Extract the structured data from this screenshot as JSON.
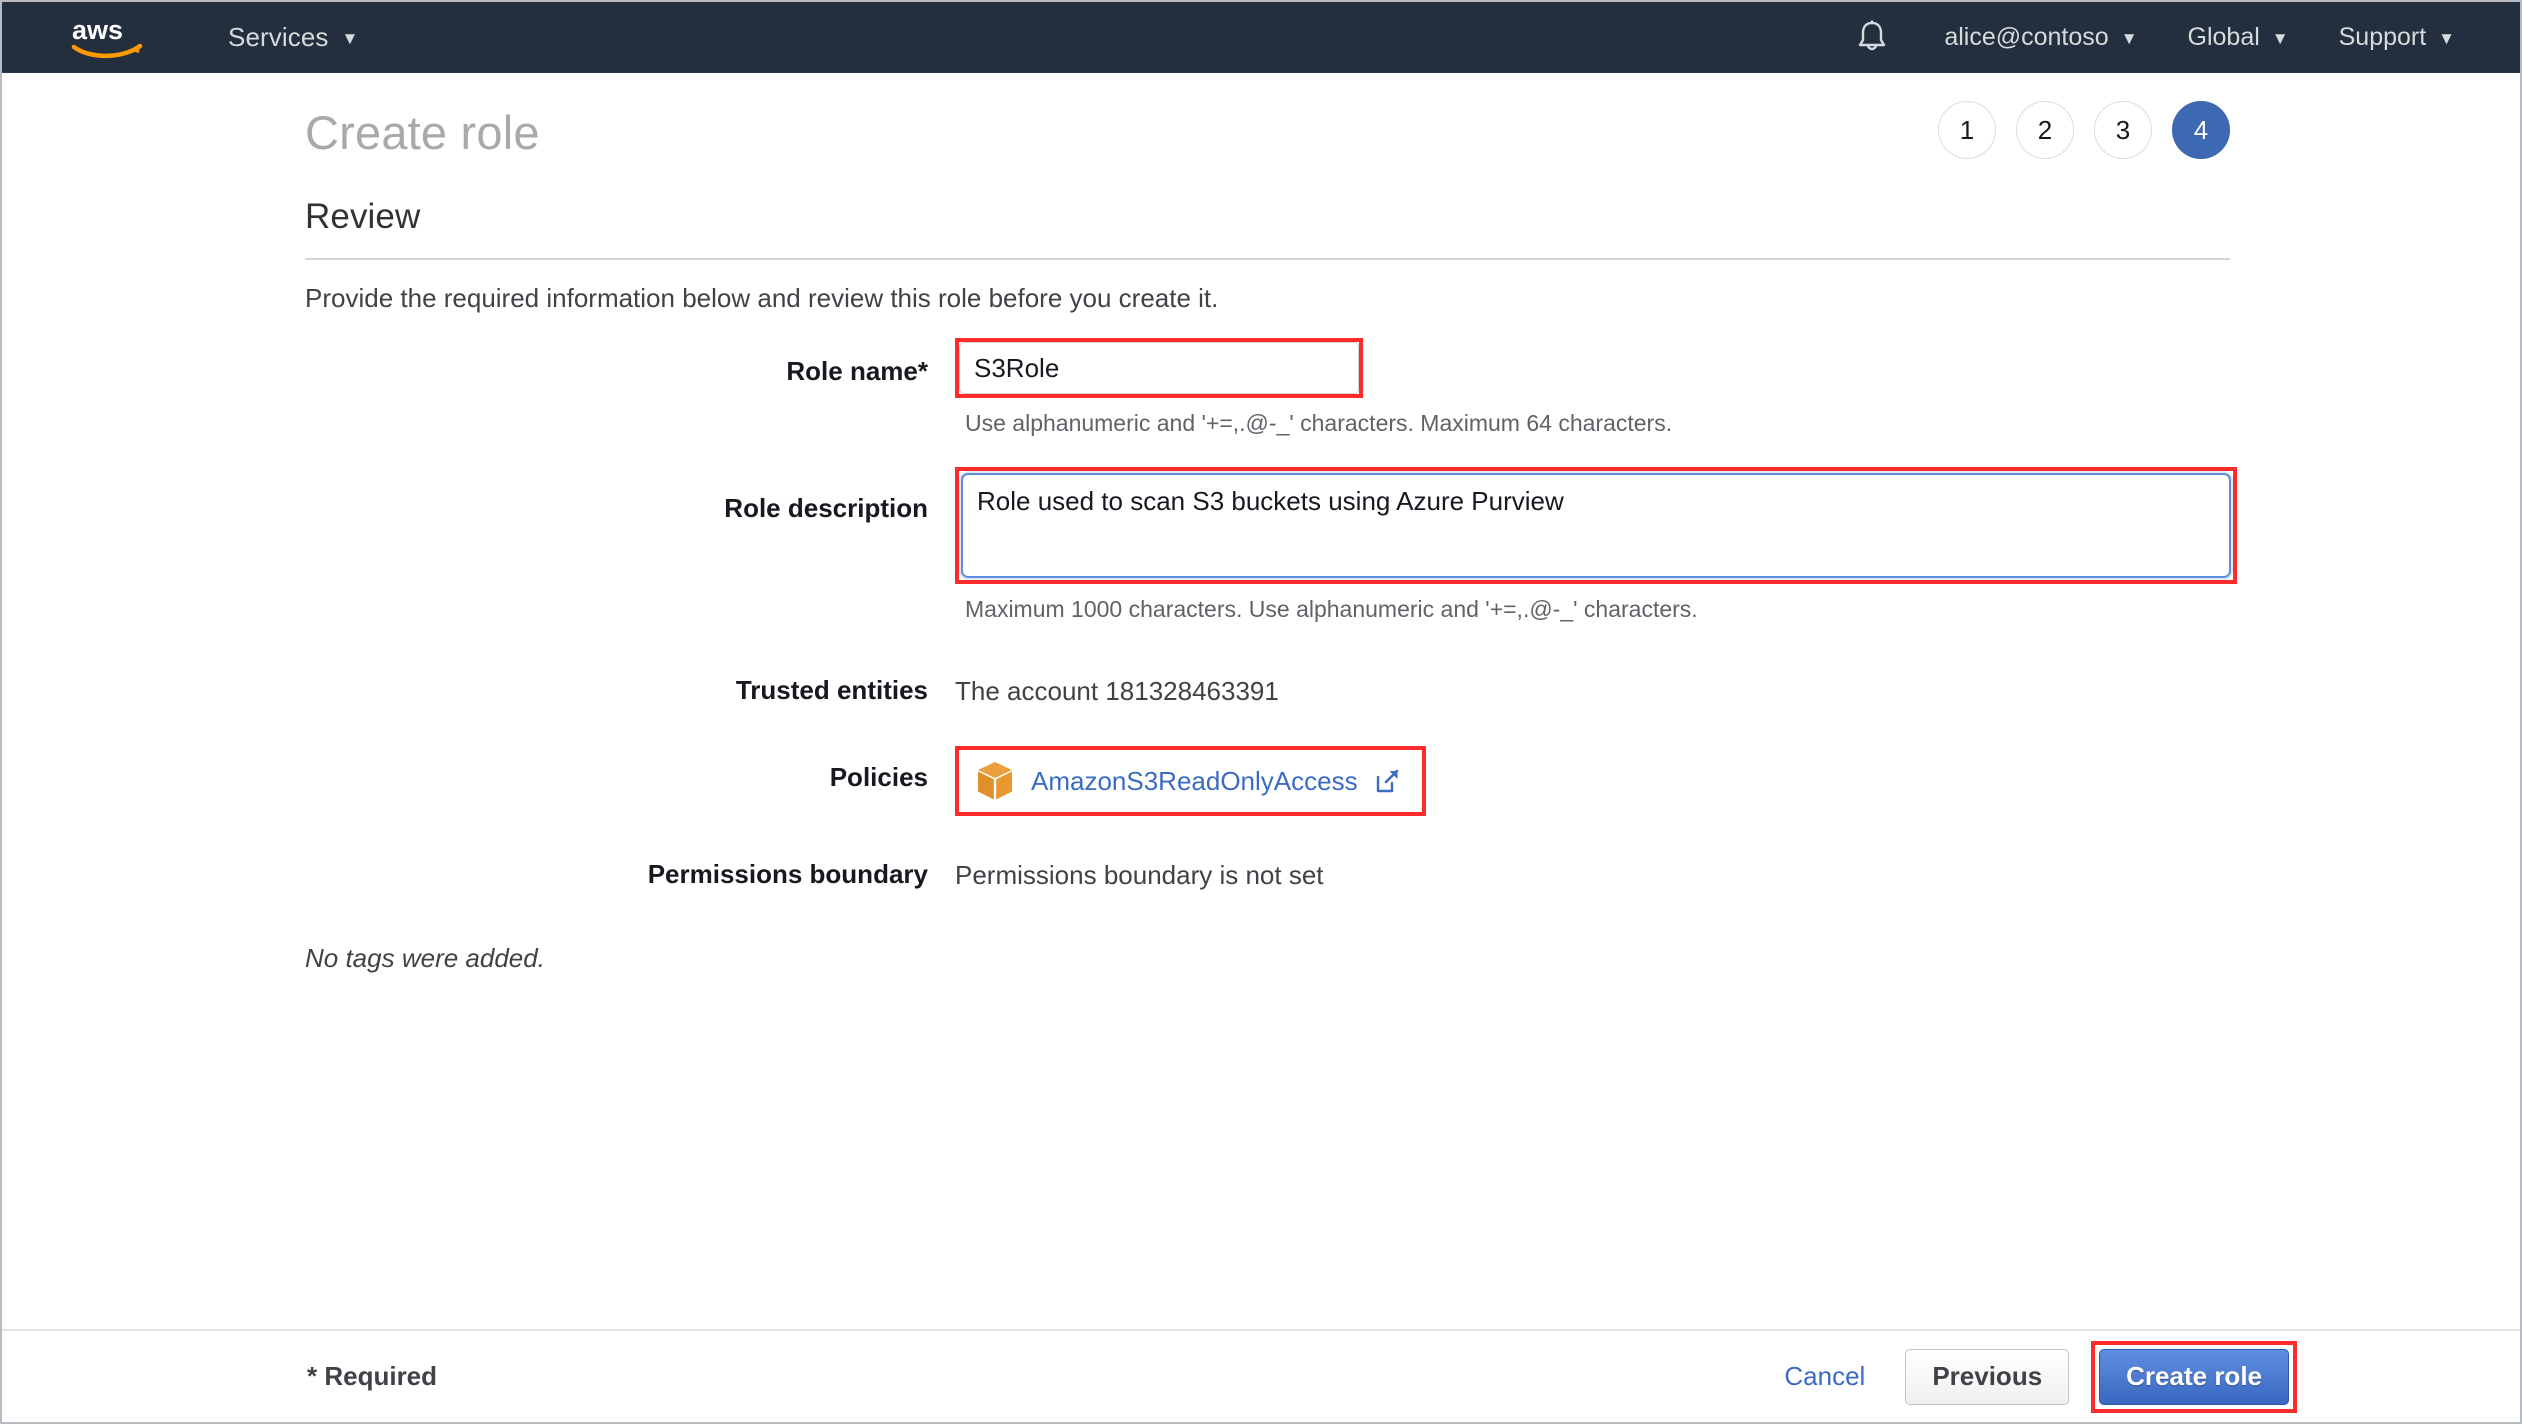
{
  "navbar": {
    "logo_alt": "aws",
    "services_label": "Services",
    "bell_icon": "notifications-bell-icon",
    "account_label": "alice@contoso",
    "region_label": "Global",
    "support_label": "Support",
    "caret": "▼"
  },
  "header": {
    "title": "Create role",
    "section_title": "Review",
    "intro": "Provide the required information below and review this role before you create it.",
    "steps": [
      {
        "label": "1",
        "active": false
      },
      {
        "label": "2",
        "active": false
      },
      {
        "label": "3",
        "active": false
      },
      {
        "label": "4",
        "active": true
      }
    ]
  },
  "form": {
    "role_name": {
      "label": "Role name*",
      "value": "S3Role",
      "placeholder": "",
      "hint": "Use alphanumeric and '+=,.@-_' characters. Maximum 64 characters."
    },
    "role_description": {
      "label": "Role description",
      "value": "Role used to scan S3 buckets using Azure Purview",
      "placeholder": "",
      "hint": "Maximum 1000 characters. Use alphanumeric and '+=,.@-_' characters."
    },
    "trusted_entities": {
      "label": "Trusted entities",
      "value": "The account 181328463391"
    },
    "policies": {
      "label": "Policies",
      "policy_name": "AmazonS3ReadOnlyAccess",
      "policy_icon": "policy-cube-icon",
      "external_icon": "external-link-icon"
    },
    "permissions_boundary": {
      "label": "Permissions boundary",
      "value": "Permissions boundary is not set"
    },
    "tags_note": "No tags were added."
  },
  "footer": {
    "required_note": "* Required",
    "cancel_label": "Cancel",
    "previous_label": "Previous",
    "create_label": "Create role"
  },
  "colors": {
    "nav_background": "#232f3e",
    "aws_orange": "#ff9900",
    "accent_blue": "#3d68b2",
    "link_blue": "#3b6cc4",
    "annotation_red": "#fc2c2c",
    "policy_icon_orange": "#e8963a"
  }
}
